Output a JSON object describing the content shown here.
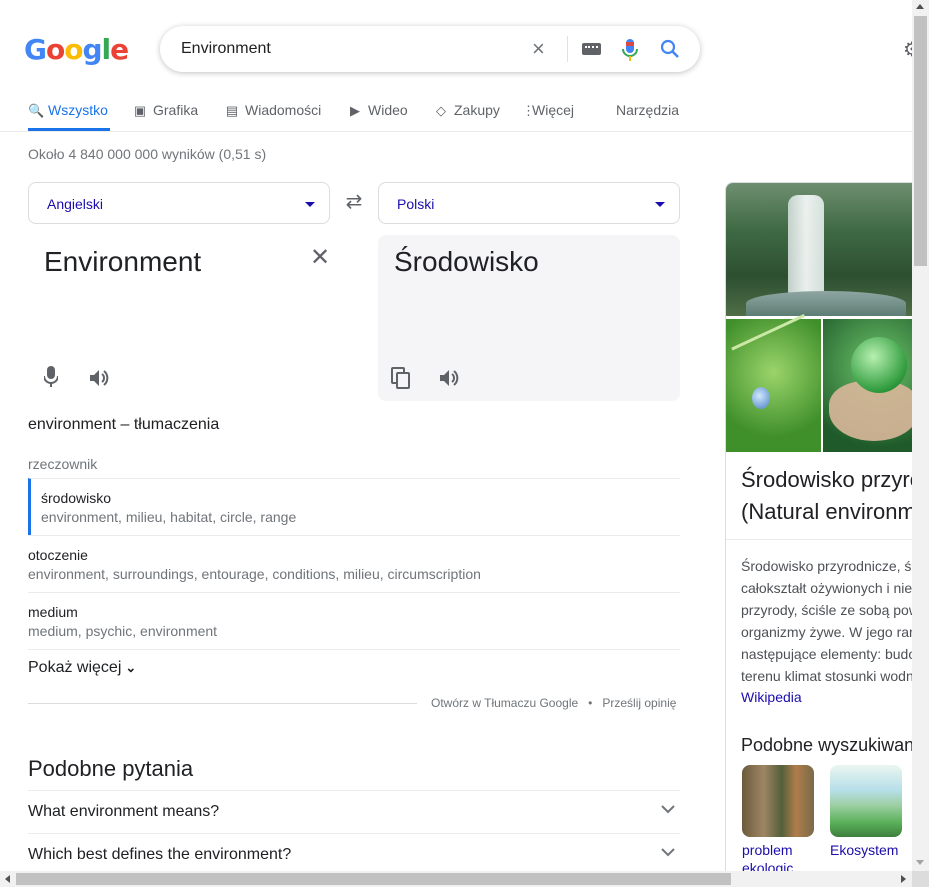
{
  "header": {
    "logo_letters": [
      {
        "ch": "G",
        "color": "#4285f4"
      },
      {
        "ch": "o",
        "color": "#ea4335"
      },
      {
        "ch": "o",
        "color": "#fbbc05"
      },
      {
        "ch": "g",
        "color": "#4285f4"
      },
      {
        "ch": "l",
        "color": "#34a853"
      },
      {
        "ch": "e",
        "color": "#ea4335"
      }
    ],
    "search": {
      "query": "Environment",
      "clear_icon": "×"
    },
    "settings_icon": "⚙"
  },
  "tabs": [
    {
      "label": "Wszystko",
      "icon": "search-icon",
      "glyph": "🔍",
      "active": true
    },
    {
      "label": "Grafika",
      "icon": "image-icon",
      "glyph": "▣"
    },
    {
      "label": "Wiadomości",
      "icon": "news-icon",
      "glyph": "▤"
    },
    {
      "label": "Wideo",
      "icon": "video-icon",
      "glyph": "▶"
    },
    {
      "label": "Zakupy",
      "icon": "tag-icon",
      "glyph": "◇"
    },
    {
      "label": "Więcej",
      "icon": "more-icon",
      "glyph": "⋮"
    },
    {
      "label": "Narzędzia",
      "icon": "",
      "glyph": ""
    }
  ],
  "result_stats": "Około 4 840 000 000 wyników (0,51 s)",
  "translator": {
    "source_lang": "Angielski",
    "target_lang": "Polski",
    "swap_icon": "⇄",
    "source_text": "Environment",
    "target_text": "Środowisko",
    "clear_icon": "✕"
  },
  "translations": {
    "heading": "environment – tłumaczenia",
    "part_of_speech": "rzeczownik",
    "rows": [
      {
        "word": "środowisko",
        "synonyms": "environment, milieu, habitat, circle, range"
      },
      {
        "word": "otoczenie",
        "synonyms": "environment, surroundings, entourage, conditions, milieu, circumscription"
      },
      {
        "word": "medium",
        "synonyms": "medium, psychic, environment"
      }
    ],
    "show_more": "Pokaż więcej",
    "open_in_translate": "Otwórz w Tłumaczu Google",
    "dot": "•",
    "feedback": "Prześlij opinię"
  },
  "people_also_ask": {
    "title": "Podobne pytania",
    "questions": [
      "What environment means?",
      "Which best defines the environment?"
    ]
  },
  "knowledge_panel": {
    "title_lines": [
      "Środowisko przyrodnicze",
      "(Natural environment)"
    ],
    "description_lines": [
      "Środowisko przyrodnicze, środowisko naturalne –",
      "całokształt ożywionych i nieożywionych składników",
      "przyrody, ściśle ze sobą powiązanych, otaczających",
      "organizmy żywe. W jego ramach można wyróżnić",
      "następujące elementy: budowę geologiczną, rzeźbę",
      "terenu klimat stosunki wodne, gleby, florę i faunę."
    ],
    "source": "Wikipedia",
    "related_title": "Podobne wyszukiwania",
    "related": [
      {
        "label_lines": [
          "problem",
          "ekologic"
        ]
      },
      {
        "label_lines": [
          "Ekosystem"
        ]
      }
    ]
  },
  "colors": {
    "accent": "#1a73e8",
    "link": "#1a0dab"
  }
}
